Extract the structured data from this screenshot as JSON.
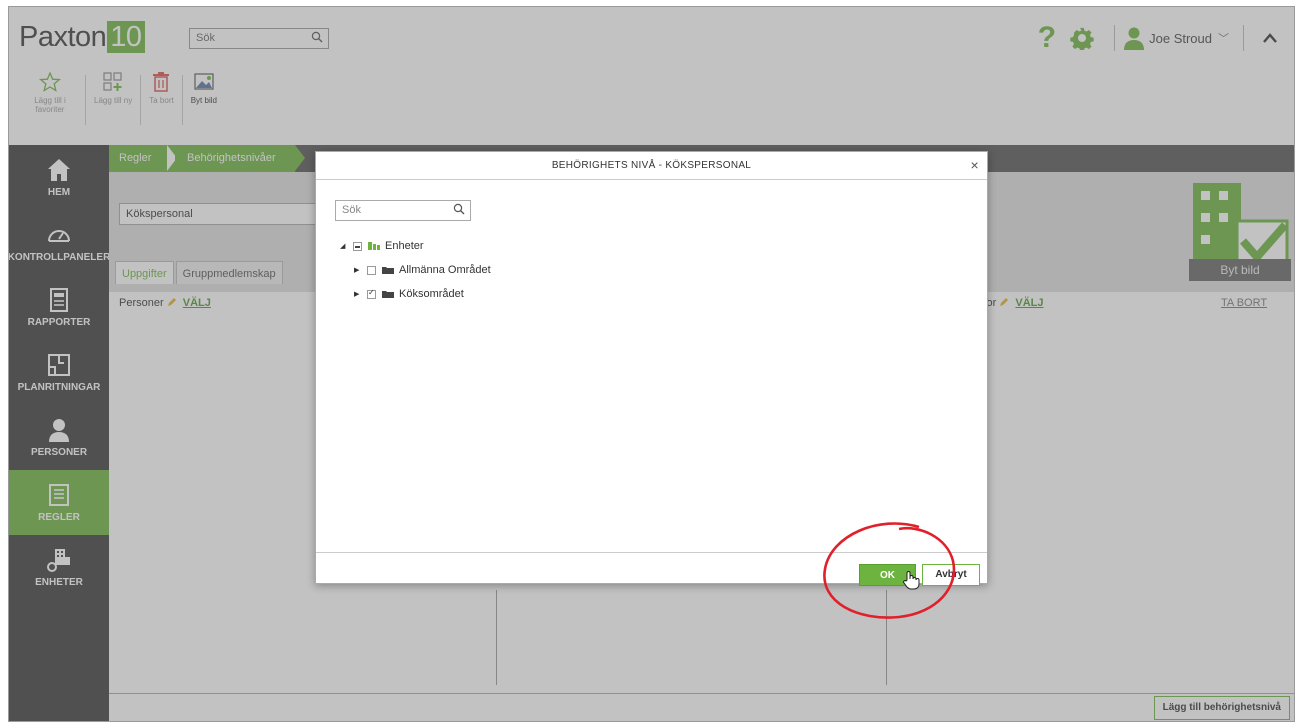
{
  "header": {
    "logo_text": "Paxton",
    "logo_number": "10",
    "search_placeholder": "Sök",
    "user_name": "Joe Stroud"
  },
  "toolbar": {
    "fav_label": "Lägg till i favoriter",
    "add_label": "Lägg till ny",
    "delete_label": "Ta bort",
    "image_label": "Byt bild"
  },
  "sidebar": {
    "items": [
      {
        "label": "HEM",
        "icon": "home-icon"
      },
      {
        "label": "KONTROLLPANELER",
        "icon": "dashboard-icon"
      },
      {
        "label": "RAPPORTER",
        "icon": "report-icon"
      },
      {
        "label": "PLANRITNINGAR",
        "icon": "floorplan-icon"
      },
      {
        "label": "PERSONER",
        "icon": "person-icon"
      },
      {
        "label": "REGLER",
        "icon": "rules-icon"
      },
      {
        "label": "ENHETER",
        "icon": "devices-icon"
      }
    ]
  },
  "breadcrumb": {
    "level1": "Regler",
    "level2": "Behörighetsnivåer"
  },
  "form": {
    "name_value": "Kökspersonal",
    "tabs": [
      "Uppgifter",
      "Gruppmedlemskap"
    ],
    "persons_label": "Personer",
    "select_label": "VÄLJ",
    "kor_label": "kor",
    "delete_link": "TA BORT",
    "change_image": "Byt bild",
    "add_level_button": "Lägg till behörighetsnivå"
  },
  "modal": {
    "title": "BEHÖRIGHETS NIVÅ - KÖKSPERSONAL",
    "close": "×",
    "search_placeholder": "Sök",
    "tree": {
      "root": "Enheter",
      "children": [
        "Allmänna Området",
        "Köksområdet"
      ]
    },
    "ok_label": "OK",
    "cancel_label": "Avbryt"
  },
  "colors": {
    "accent": "#6cb33f",
    "sidebar": "#3b3b3b",
    "annotation": "#e0202a"
  }
}
